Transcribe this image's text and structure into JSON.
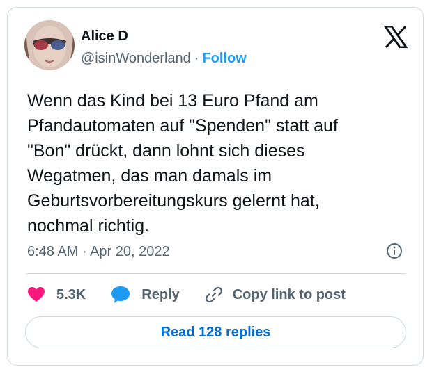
{
  "author": {
    "name": "Alice D",
    "handle": "@isinWonderland",
    "separator": "·",
    "follow_label": "Follow"
  },
  "tweet": {
    "lines": [
      "Wenn das Kind bei 13 Euro Pfand am",
      "Pfandautomaten auf \"Spenden\" statt auf",
      "\"Bon\" drückt, dann lohnt sich dieses",
      "Wegatmen, das man damals im",
      "Geburtsvorbereitungskurs gelernt hat,",
      "nochmal richtig."
    ],
    "time": "6:48 AM",
    "separator": "·",
    "date": "Apr 20, 2022"
  },
  "actions": {
    "like_count": "5.3K",
    "reply_label": "Reply",
    "copy_label": "Copy link to post"
  },
  "footer": {
    "read_replies_label": "Read 128 replies"
  },
  "icons": {
    "platform": "x-logo-icon",
    "info": "info-icon",
    "like": "heart-icon",
    "reply": "speech-bubble-icon",
    "copy": "link-icon"
  },
  "colors": {
    "text": "#0f1419",
    "secondary": "#536471",
    "accent": "#1d9bf0",
    "like": "#f91880",
    "reply": "#1d9bf0",
    "read_button_text": "#006fd6",
    "border": "#cfd9de"
  }
}
